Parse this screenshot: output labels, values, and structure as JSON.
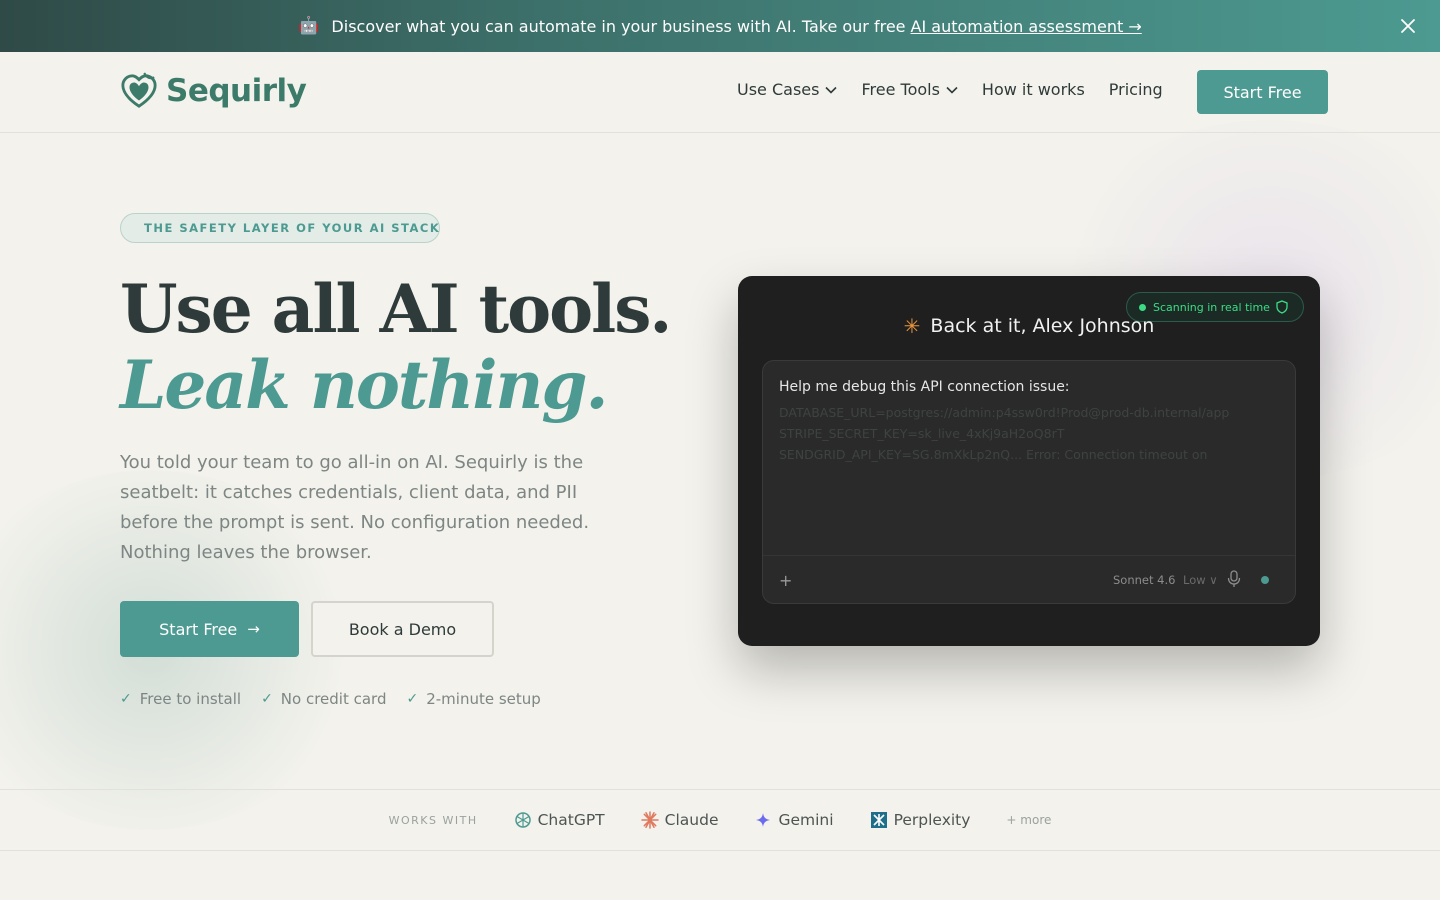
{
  "announcement": {
    "icon": "robot-emoji",
    "emoji": "🤖",
    "text": "Discover what you can automate in your business with AI. Take our free",
    "link_text": "AI automation assessment →"
  },
  "header": {
    "brand": "Sequirly",
    "nav": [
      {
        "label": "Use Cases",
        "dropdown": true
      },
      {
        "label": "Free Tools",
        "dropdown": true
      },
      {
        "label": "How it works",
        "dropdown": false
      },
      {
        "label": "Pricing",
        "dropdown": false
      }
    ],
    "cta": "Start Free"
  },
  "hero": {
    "eyebrow": "THE SAFETY LAYER OF YOUR AI STACK",
    "title_line1": "Use all AI tools.",
    "title_line2": "Leak nothing.",
    "lead": "You told your team to go all-in on AI. Sequirly is the seatbelt: it catches credentials, client data, and PII before the prompt is sent. No configuration needed. Nothing leaves the browser.",
    "primary_cta": "Start Free",
    "secondary_cta": "Book a Demo",
    "checks": [
      "Free to install",
      "No credit card",
      "2-minute setup"
    ]
  },
  "demo": {
    "badge": "Scanning in real time",
    "greeting": "Back at it, Alex Johnson",
    "prompt": "Help me debug this API connection issue:",
    "secret_lines": [
      "DATABASE_URL=postgres://admin:p4ssw0rd!Prod@prod-db.internal/app",
      "STRIPE_SECRET_KEY=sk_live_4xKj9aH2oQ8rT",
      "SENDGRID_API_KEY=SG.8mXkLp2nQ... Error: Connection timeout on"
    ],
    "model": "Sonnet 4.6",
    "effort": "Low ∨"
  },
  "works_with": {
    "label": "WORKS WITH",
    "brands": [
      "ChatGPT",
      "Claude",
      "Gemini",
      "Perplexity"
    ],
    "more": "+ more"
  },
  "colors": {
    "accent": "#4c9a91",
    "dark_text": "#2f3b3a",
    "background": "#f3f2ec",
    "card": "#1f1f1f"
  }
}
